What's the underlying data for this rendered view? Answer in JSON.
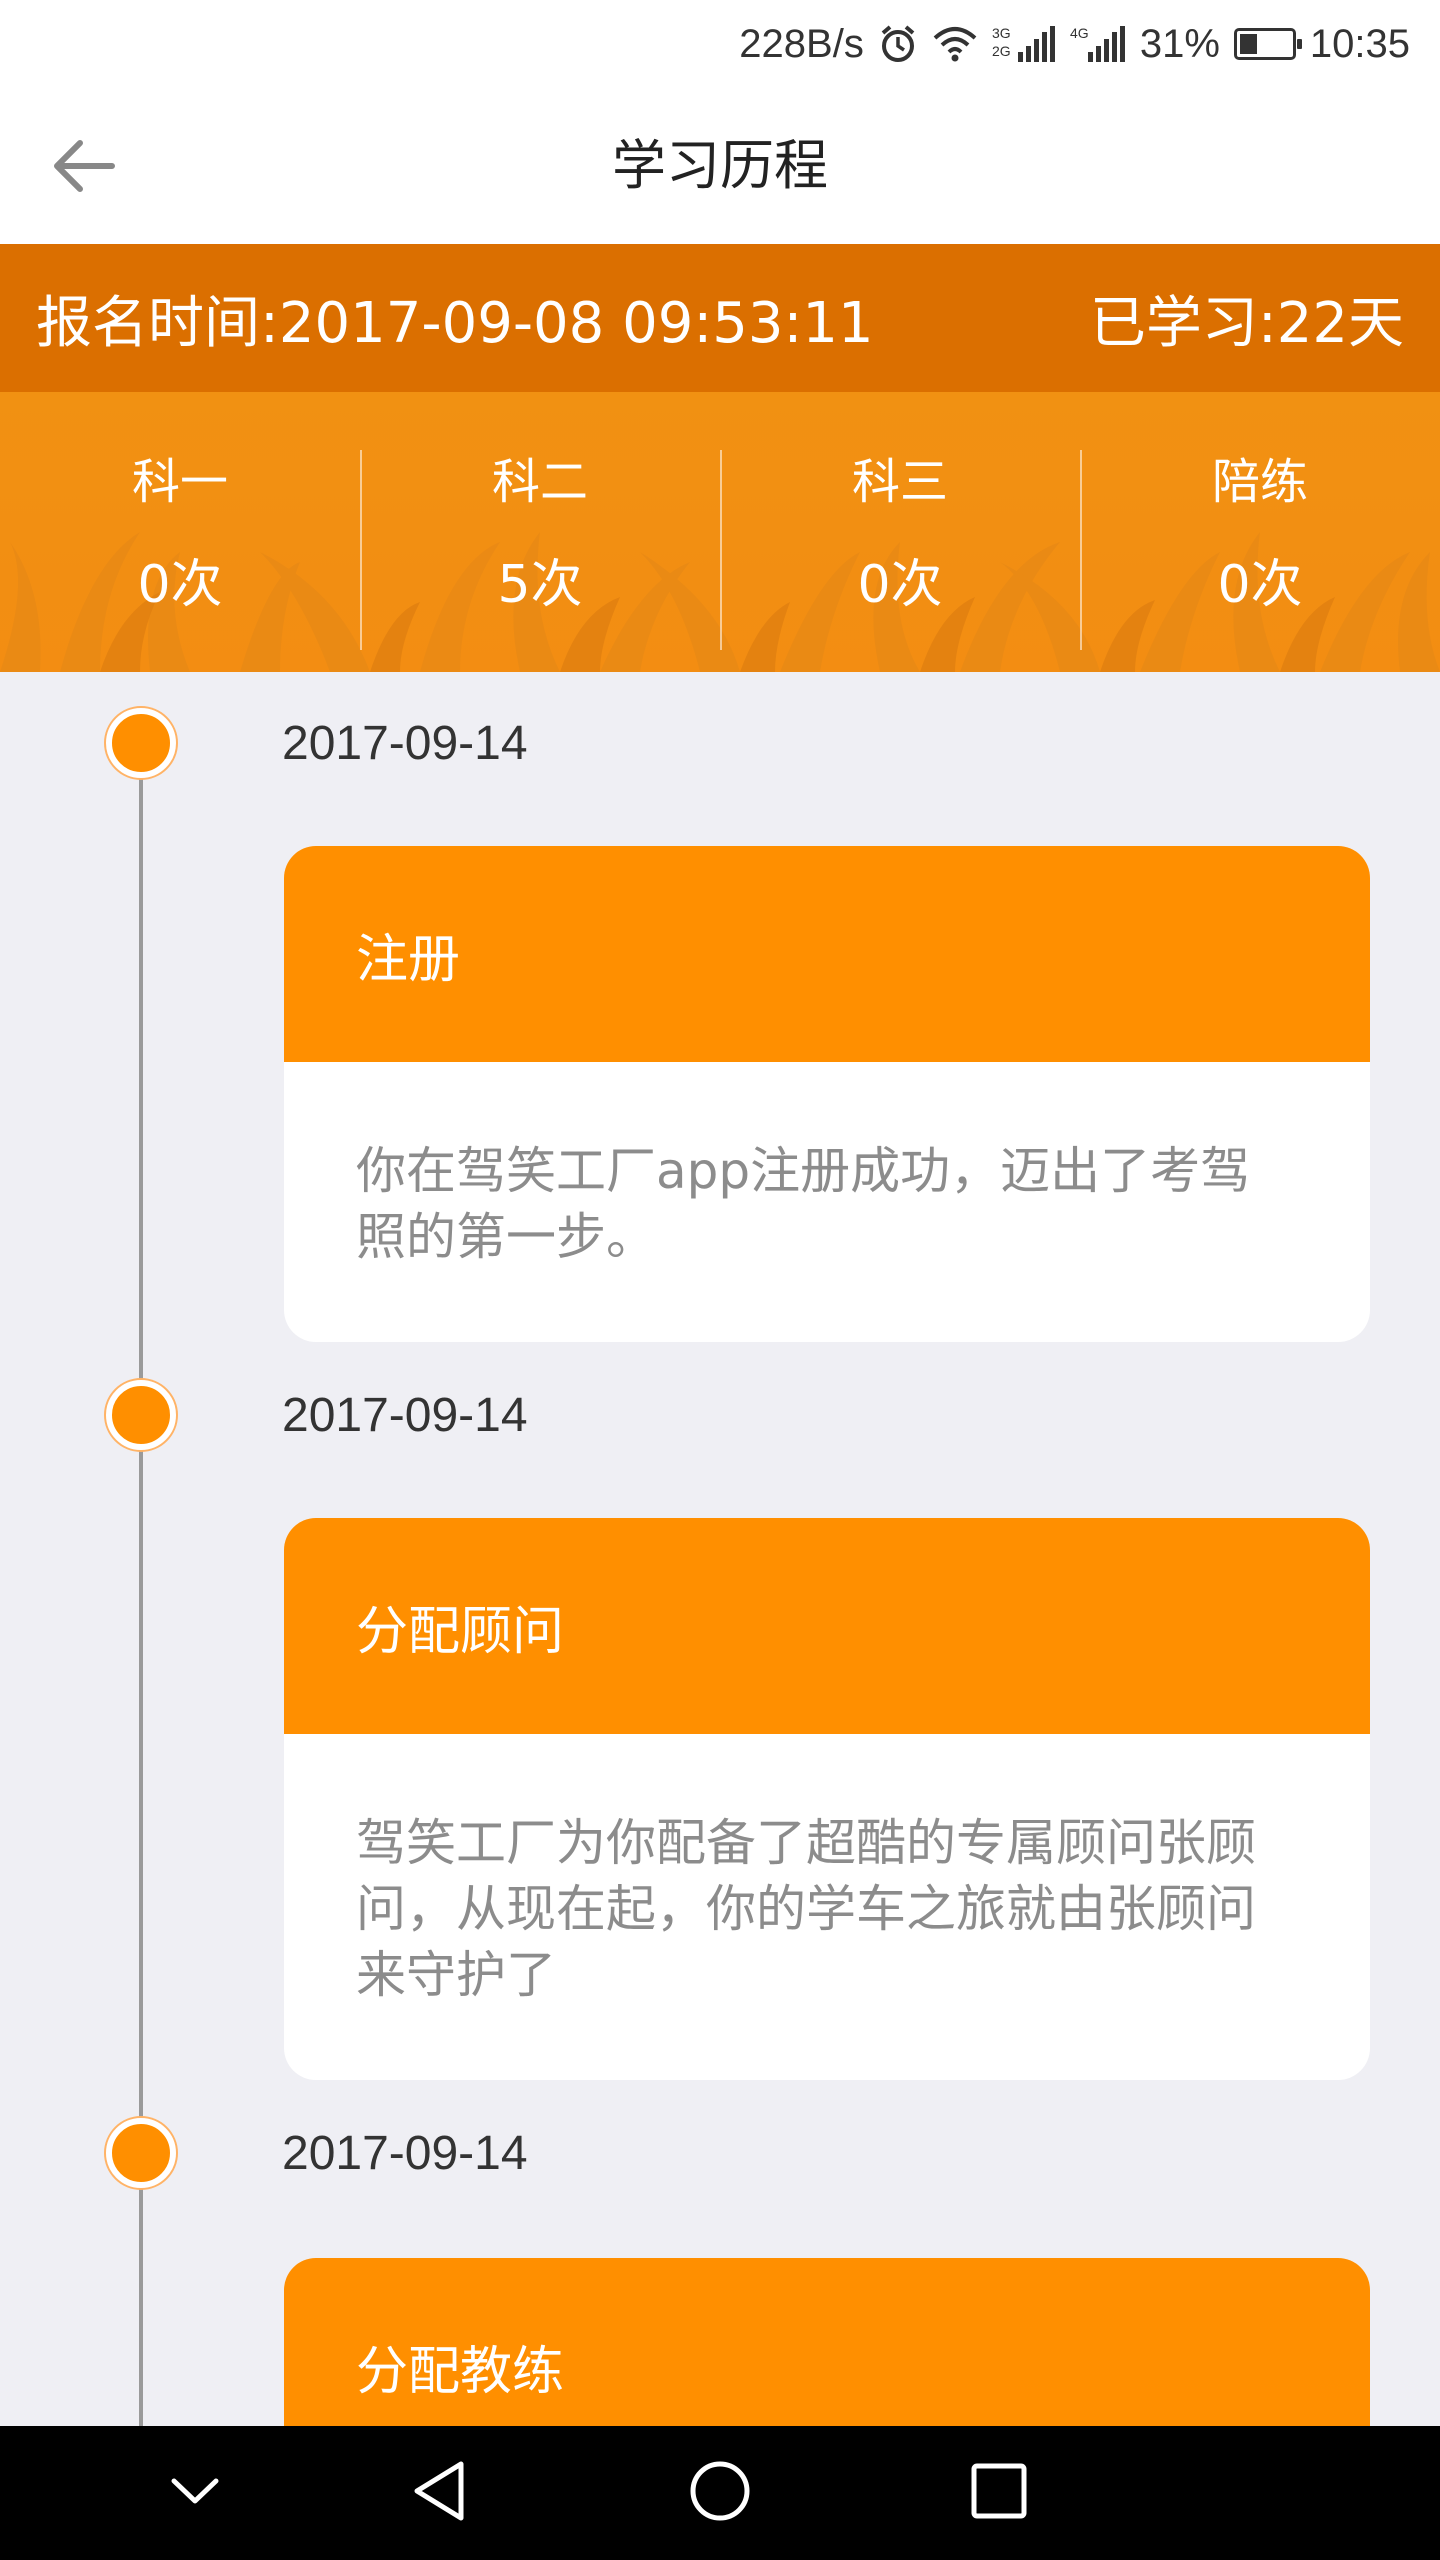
{
  "status_bar": {
    "speed": "228B/s",
    "network_labels": [
      "3G",
      "2G",
      "4G"
    ],
    "battery": "31%",
    "battery_level": 0.31,
    "time": "10:35",
    "icons": [
      "alarm-icon",
      "wifi-icon",
      "signal-icon",
      "battery-icon"
    ]
  },
  "header": {
    "title": "学习历程",
    "back_icon": "arrow-left-icon"
  },
  "enrollment": {
    "time_text": "报名时间:2017-09-08 09:53:11",
    "days_text": "已学习:22天"
  },
  "stats": [
    {
      "label": "科一",
      "count": "0次"
    },
    {
      "label": "科二",
      "count": "5次"
    },
    {
      "label": "科三",
      "count": "0次"
    },
    {
      "label": "陪练",
      "count": "0次"
    }
  ],
  "timeline": [
    {
      "date": "2017-09-14",
      "title": "注册",
      "body": "你在驾笑工厂app注册成功，迈出了考驾照的第一步。"
    },
    {
      "date": "2017-09-14",
      "title": "分配顾问",
      "body": "驾笑工厂为你配备了超酷的专属顾问张顾问，从现在起，你的学车之旅就由张顾问来守护了"
    },
    {
      "date": "2017-09-14",
      "title": "分配教练",
      "body": ""
    }
  ],
  "nav_bar": {
    "icons": [
      "collapse-icon",
      "back-triangle-icon",
      "home-circle-icon",
      "recents-square-icon"
    ]
  },
  "colors": {
    "accent": "#ff8f00",
    "enroll_bar": "#db6f00",
    "stats_bg": "#f19112",
    "page_bg": "#efeff4"
  }
}
